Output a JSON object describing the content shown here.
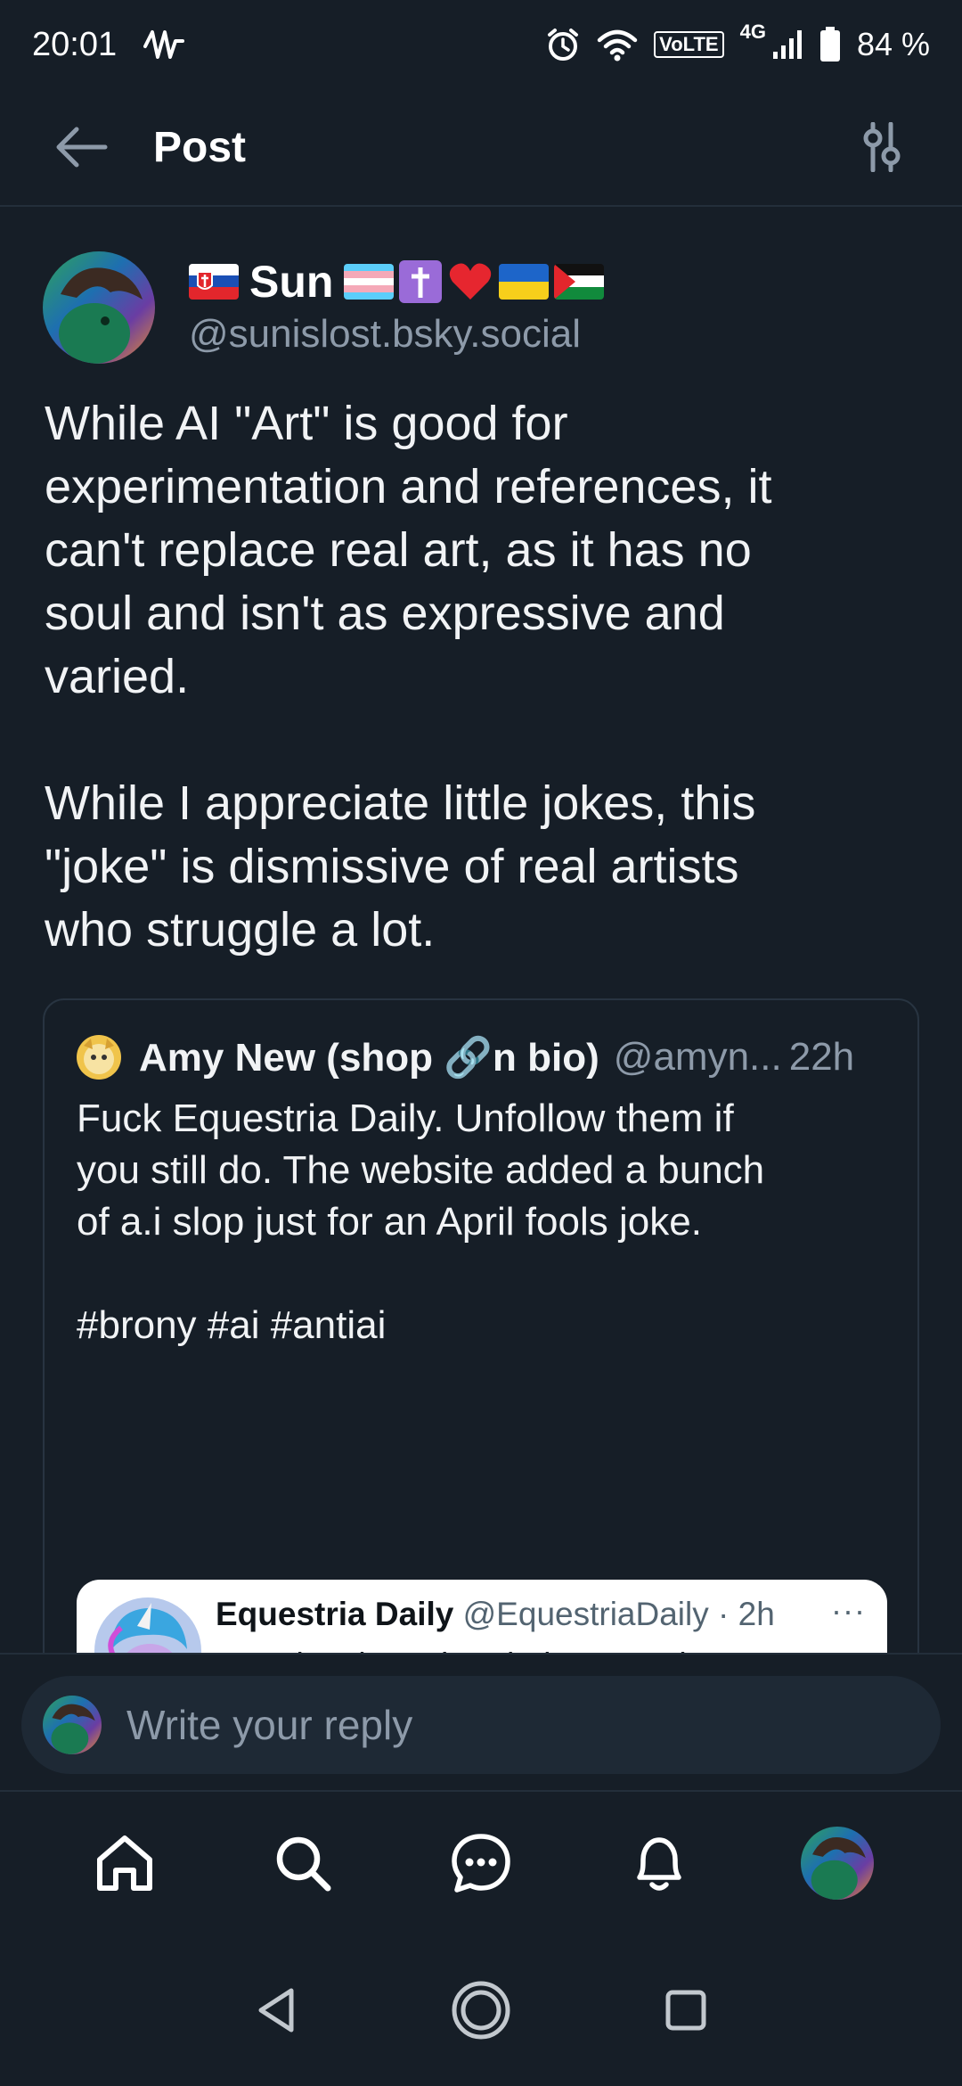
{
  "status_bar": {
    "time": "20:01",
    "network_label": "VoLTE",
    "cell_label": "4G",
    "battery_text": "84 %"
  },
  "header": {
    "title": "Post",
    "back_icon": "arrow-left-icon",
    "filter_icon": "sliders-icon"
  },
  "post": {
    "display_name": "Sun",
    "handle": "@sunislost.bsky.social",
    "flags": [
      "slovakia-flag",
      "trans-flag",
      "latin-cross-emoji",
      "red-heart-emoji",
      "ukraine-flag",
      "palestine-flag"
    ],
    "text": "While AI \"Art\" is good for\nexperimentation and references, it\ncan't replace real art, as it has no\nsoul and isn't as expressive and\nvaried.\n\nWhile I appreciate little jokes, this\n\"joke\" is dismissive of real artists\nwho struggle a lot."
  },
  "quote": {
    "name": "Amy New (shop 🔗n bio)",
    "handle": "@amyn...",
    "time": "22h",
    "text": "Fuck Equestria Daily. Unfollow them if\nyou still do. The website added a bunch\nof a.i slop just for an April fools joke.\n\n#brony #ai #antiai",
    "embedded_tweet": {
      "name": "Equestria Daily",
      "handle": "@EquestriaDaily",
      "time": "· 2h",
      "more": "···",
      "text": "EQD has been handed over to the\nROBOTS. ALL HAIL our ROBOT\nOVERLORDS.\n\nTHE SLOP IS NOW."
    }
  },
  "reply": {
    "placeholder": "Write your reply"
  },
  "bottom_nav": {
    "items": [
      "home-icon",
      "search-icon",
      "chat-icon",
      "bell-icon",
      "profile-avatar"
    ]
  },
  "system_nav": {
    "items": [
      "back-triangle-icon",
      "home-circle-icon",
      "recents-square-icon"
    ]
  },
  "colors": {
    "background": "#161e27",
    "divider": "#232e3a",
    "muted_text": "#8d9aa9",
    "reply_box": "#1e2935"
  }
}
